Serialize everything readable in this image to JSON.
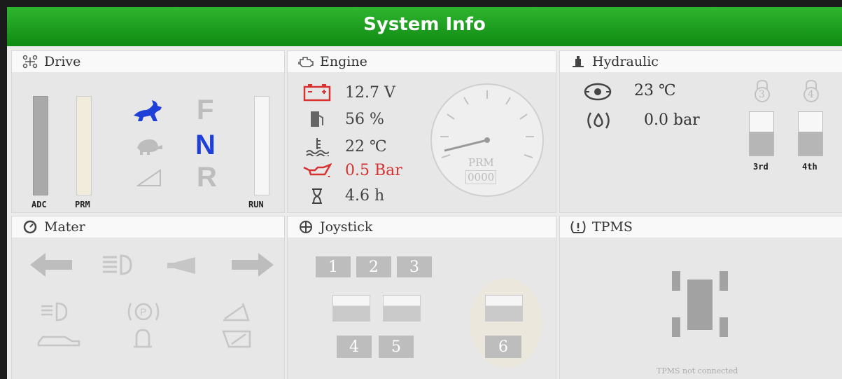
{
  "header": {
    "title": "System Info"
  },
  "drive": {
    "title": "Drive",
    "bars": {
      "adc": "ADC",
      "prm": "PRM",
      "run": "RUN"
    },
    "gears": {
      "forward": "F",
      "neutral": "N",
      "reverse": "R"
    },
    "active_gear": "N",
    "colors": {
      "active": "#1f3fd9",
      "inactive": "#bdbdbd"
    }
  },
  "engine": {
    "title": "Engine",
    "voltage": "12.7 V",
    "fuel": "56 %",
    "coolant_temp": "22 ℃",
    "oil_pressure": "0.5 Bar",
    "hours": "4.6 h",
    "gauge": {
      "label": "PRM",
      "value": "0000"
    },
    "colors": {
      "warning": "#d63232"
    }
  },
  "hydraulic": {
    "title": "Hydraulic",
    "temperature": "23 ℃",
    "pressure": "0.0 bar",
    "lock_3": "3",
    "lock_4": "4",
    "slot_3_label": "3rd",
    "slot_4_label": "4th"
  },
  "meter": {
    "title": "Mater"
  },
  "joystick": {
    "title": "Joystick",
    "buttons": [
      "1",
      "2",
      "3",
      "4",
      "5",
      "6"
    ]
  },
  "tpms": {
    "title": "TPMS",
    "status": "TPMS not connected"
  }
}
